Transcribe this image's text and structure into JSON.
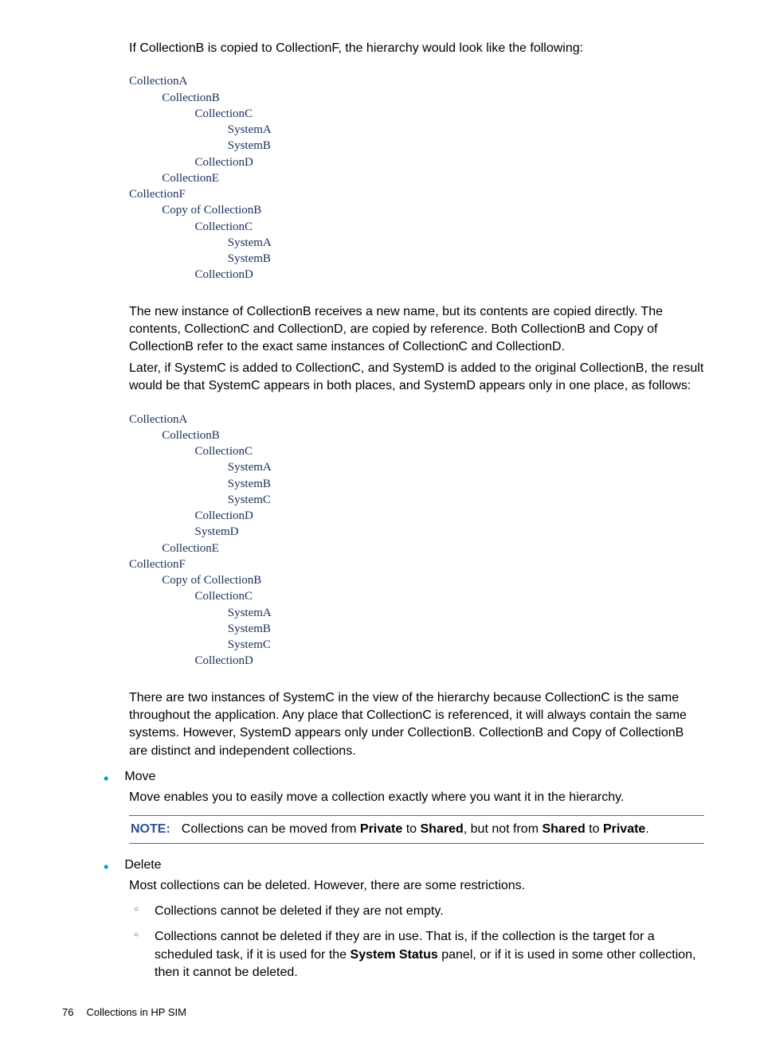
{
  "intro": "If CollectionB is copied to CollectionF, the hierarchy would look like the following:",
  "tree1": {
    "l0a": "CollectionA",
    "l1a": "CollectionB",
    "l2a": "CollectionC",
    "l3a": "SystemA",
    "l3b": "SystemB",
    "l2b": "CollectionD",
    "l1b": "CollectionE",
    "l0b": "CollectionF",
    "l1c": "Copy of CollectionB",
    "l2c": "CollectionC",
    "l3c": "SystemA",
    "l3d": "SystemB",
    "l2d": "CollectionD"
  },
  "para1": "The new instance of CollectionB receives a new name, but its contents are copied directly. The contents, CollectionC and CollectionD, are copied by reference. Both CollectionB and Copy of CollectionB refer to the exact same instances of CollectionC and CollectionD.",
  "para2": "Later, if SystemC is added to CollectionC, and SystemD is added to the original CollectionB, the result would be that SystemC appears in both places, and SystemD appears only in one place, as follows:",
  "tree2": {
    "l0a": "CollectionA",
    "l1a": "CollectionB",
    "l2a": "CollectionC",
    "l3a": "SystemA",
    "l3b": "SystemB",
    "l3c": "SystemC",
    "l2b": "CollectionD",
    "l2c": "SystemD",
    "l1b": "CollectionE",
    "l0b": "CollectionF",
    "l1c": "Copy of CollectionB",
    "l2d": "CollectionC",
    "l3d": "SystemA",
    "l3e": "SystemB",
    "l3f": "SystemC",
    "l2e": "CollectionD"
  },
  "para3": "There are two instances of SystemC in the view of the hierarchy because CollectionC is the same throughout the application. Any place that CollectionC is referenced, it will always contain the same systems. However, SystemD appears only under CollectionB. CollectionB and Copy of CollectionB are distinct and independent collections.",
  "bullets": {
    "move": {
      "title": "Move",
      "desc": "Move enables you to easily move a collection exactly where you want it in the hierarchy."
    },
    "delete": {
      "title": "Delete",
      "desc": "Most collections can be deleted. However, there are some restrictions.",
      "sub1": "Collections cannot be deleted if they are not empty.",
      "sub2a": "Collections cannot be deleted if they are in use. That is, if the collection is the target for a scheduled task, if it is used for the ",
      "sub2bold": "System Status",
      "sub2b": " panel, or if it is used in some other collection, then it cannot be deleted."
    }
  },
  "note": {
    "label": "NOTE:",
    "t1": "Collections can be moved from ",
    "b1": "Private",
    "t2": " to ",
    "b2": "Shared",
    "t3": ", but not from ",
    "b3": "Shared",
    "t4": " to ",
    "b4": "Private",
    "t5": "."
  },
  "footer": {
    "pagenum": "76",
    "title": "Collections in HP SIM"
  }
}
